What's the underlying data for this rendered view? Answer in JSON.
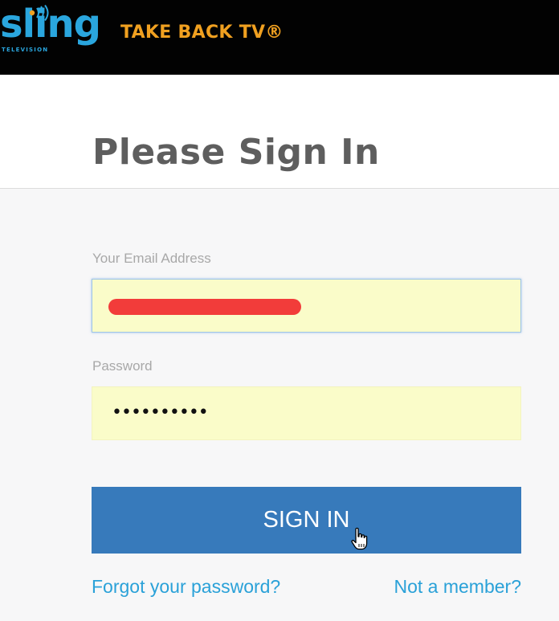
{
  "header": {
    "logo_text": "sling",
    "logo_subtext": "TELEVISION",
    "tagline": "TAKE BACK TV®"
  },
  "page": {
    "title": "Please Sign In"
  },
  "form": {
    "email_label": "Your Email Address",
    "email_value": "",
    "email_redacted": true,
    "password_label": "Password",
    "password_mask": "••••••••••",
    "signin_label": "SIGN IN"
  },
  "links": {
    "forgot": "Forgot your password?",
    "member": "Not a member?"
  },
  "colors": {
    "header_bg": "#020202",
    "brand_blue": "#2aa6de",
    "tagline_orange": "#f0a020",
    "button_blue": "#377abb",
    "input_fill": "#fafcc9",
    "redaction_red": "#f23c3a",
    "link_blue": "#2aa1d8"
  },
  "icons": {
    "logo_signal": "signal-waves-icon",
    "cursor": "hand-pointer-icon"
  }
}
